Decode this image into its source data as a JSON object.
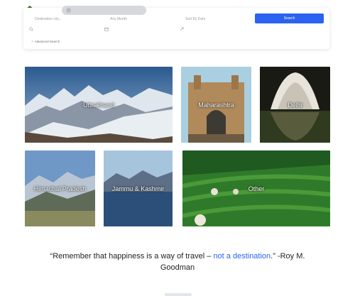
{
  "search": {
    "destination_placeholder": "Destination city...",
    "month_label": "Any Month",
    "sort_label": "Sort By Date",
    "button_label": "Search",
    "advanced_label": "Advanced Search",
    "advanced_icon": "plus-icon"
  },
  "destinations": [
    {
      "name": "Uttrakhand"
    },
    {
      "name": "Maharashtra"
    },
    {
      "name": "Delhi"
    },
    {
      "name": "Himachal Pradesh"
    },
    {
      "name": "Jammu & Kashmir"
    },
    {
      "name": "Other"
    }
  ],
  "quote": {
    "part1": "“Remember that happiness is a way of travel – ",
    "highlight": "not a destination",
    "part2": ".” -Roy M. Goodman"
  },
  "colors": {
    "accent": "#2b62ef"
  }
}
